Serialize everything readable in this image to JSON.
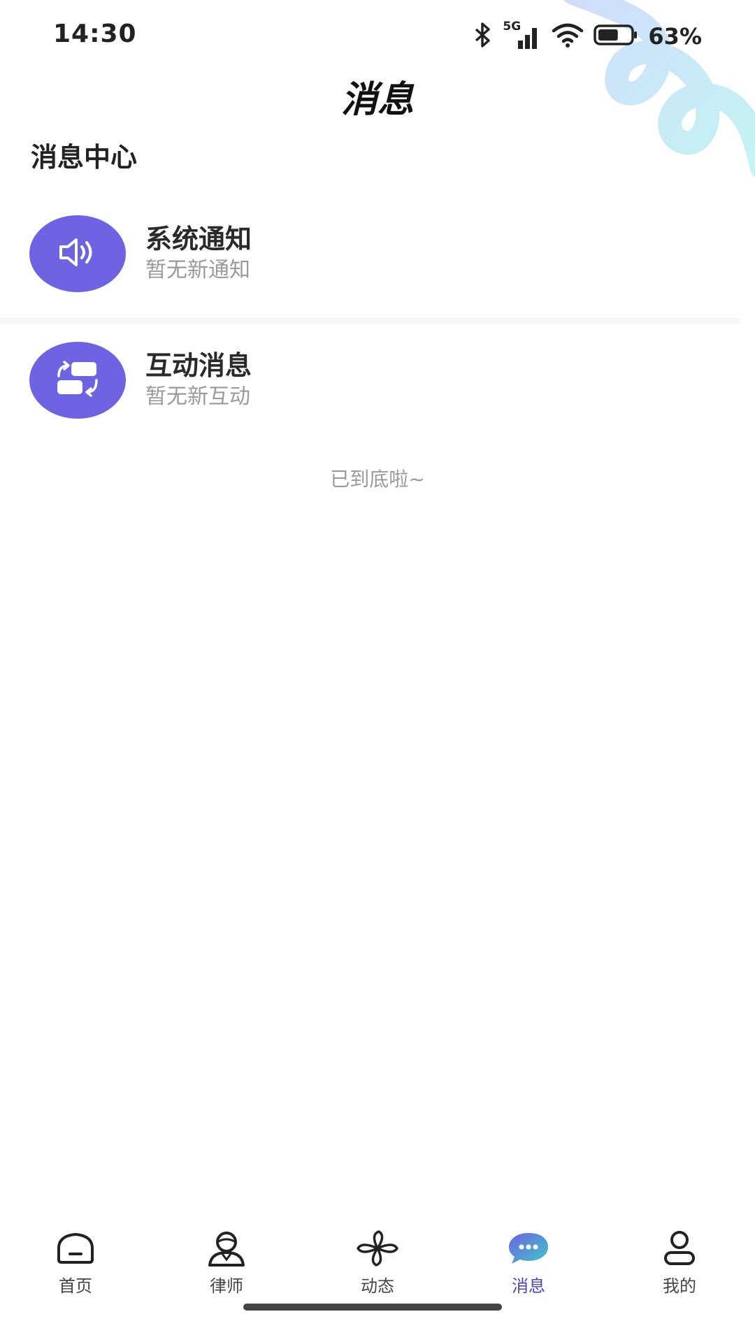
{
  "status_bar": {
    "time": "14:30",
    "network": "5G",
    "battery_percent": "63%",
    "battery_level": 0.63,
    "icons": [
      "bluetooth-icon",
      "signal-icon",
      "wifi-icon",
      "battery-icon"
    ]
  },
  "header": {
    "title": "消息"
  },
  "section": {
    "title": "消息中心"
  },
  "messages": [
    {
      "title": "系统通知",
      "subtitle": "暂无新通知",
      "icon": "speaker-icon"
    },
    {
      "title": "互动消息",
      "subtitle": "暂无新互动",
      "icon": "interaction-icon"
    }
  ],
  "end_tip": "已到底啦~",
  "tabbar": {
    "tabs": [
      {
        "label": "首页",
        "icon": "home-icon",
        "active": false
      },
      {
        "label": "律师",
        "icon": "lawyer-icon",
        "active": false
      },
      {
        "label": "动态",
        "icon": "pinwheel-icon",
        "active": false
      },
      {
        "label": "消息",
        "icon": "chat-bubble-icon",
        "active": true
      },
      {
        "label": "我的",
        "icon": "profile-icon",
        "active": false
      }
    ]
  },
  "colors": {
    "accent": "#6d63e3",
    "active_tab": "#4b47b8",
    "muted_text": "#9a9a9a"
  }
}
